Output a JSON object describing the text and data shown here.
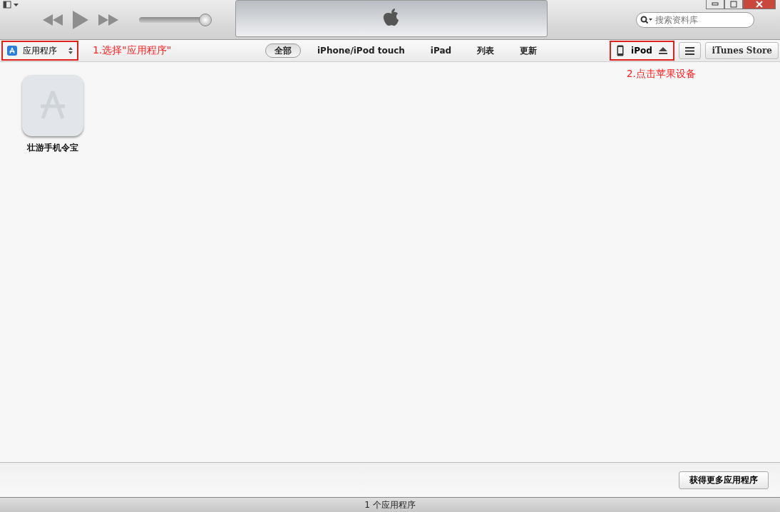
{
  "player": {
    "volume": {
      "level": 0.93
    }
  },
  "search": {
    "placeholder": "搜索资料库"
  },
  "library_selector": {
    "label": "应用程序",
    "highlighted": true
  },
  "annotations": [
    {
      "text": "1.选择\"应用程序\""
    },
    {
      "text": "2.点击苹果设备"
    }
  ],
  "tabs": [
    {
      "label": "全部",
      "selected": true
    },
    {
      "label": "iPhone/iPod touch",
      "selected": false
    },
    {
      "label": "iPad",
      "selected": false
    },
    {
      "label": "列表",
      "selected": false
    },
    {
      "label": "更新",
      "selected": false
    }
  ],
  "device": {
    "label": "iPod",
    "highlighted": true
  },
  "store_button": "iTunes Store",
  "apps": [
    {
      "name": "壮游手机令宝"
    }
  ],
  "more_button": "获得更多应用程序",
  "status_bar": "1 个应用程序"
}
